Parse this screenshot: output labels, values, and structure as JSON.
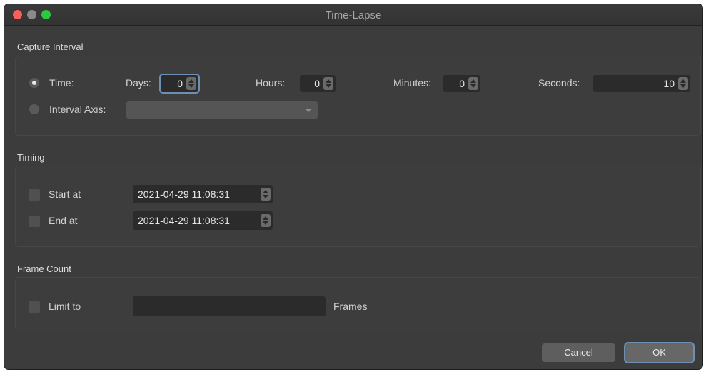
{
  "window": {
    "title": "Time-Lapse"
  },
  "capture_interval": {
    "heading": "Capture Interval",
    "mode_time_label": "Time:",
    "mode_axis_label": "Interval Axis:",
    "days_label": "Days:",
    "days_value": "0",
    "hours_label": "Hours:",
    "hours_value": "0",
    "minutes_label": "Minutes:",
    "minutes_value": "0",
    "seconds_label": "Seconds:",
    "seconds_value": "10",
    "interval_axis_value": ""
  },
  "timing": {
    "heading": "Timing",
    "start_label": "Start at",
    "start_value": "2021-04-29 11:08:31",
    "end_label": "End at",
    "end_value": "2021-04-29 11:08:31"
  },
  "frame_count": {
    "heading": "Frame Count",
    "limit_label": "Limit to",
    "limit_value": "",
    "unit_label": "Frames"
  },
  "buttons": {
    "cancel": "Cancel",
    "ok": "OK"
  }
}
